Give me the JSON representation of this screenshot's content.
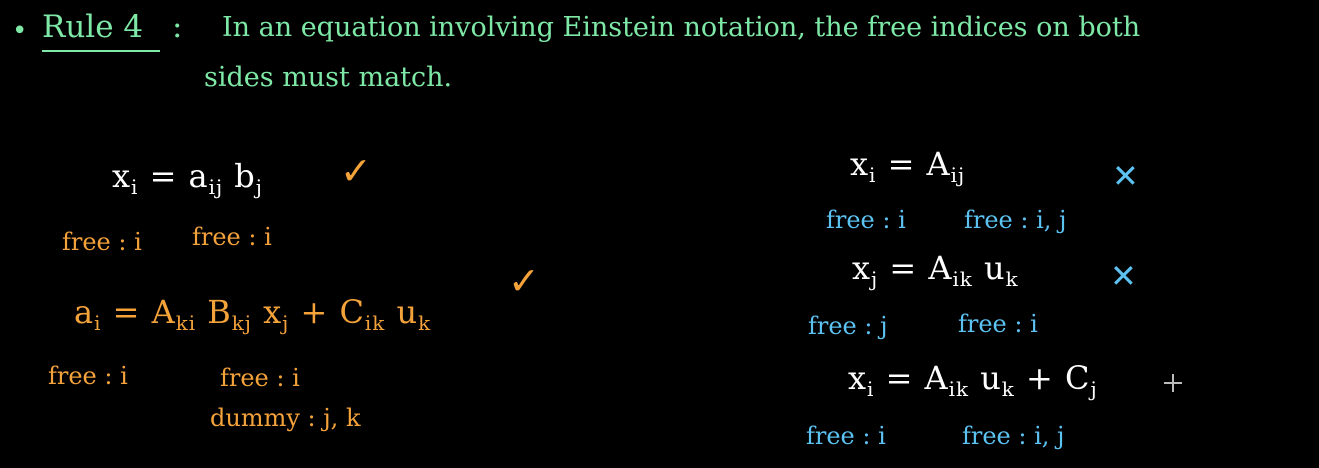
{
  "rule": {
    "bullet": "•",
    "title": "Rule 4",
    "colon": ":",
    "line1": "In an equation involving Einstein notation, the free indices on both",
    "line2": "sides must match."
  },
  "left": {
    "eq1": {
      "pre": "x",
      "s1": "i",
      "m1": " = a",
      "s2": "ij",
      "m2": " b",
      "s3": "j"
    },
    "eq1_mark": "✓",
    "eq1_label_a": "free : i",
    "eq1_label_b": "free : i",
    "eq2": {
      "pre": "a",
      "s1": "i",
      "m1": " = A",
      "s2": "ki",
      "m2": " B",
      "s3": "kj",
      "m3": " x",
      "s4": "j",
      "m4": "  +  C",
      "s5": "ik",
      "m5": " u",
      "s6": "k"
    },
    "eq2_mark": "✓",
    "eq2_label_a": "free : i",
    "eq2_label_b": "free : i",
    "eq2_label_c": "dummy : j, k"
  },
  "right": {
    "eq1": {
      "pre": "x",
      "s1": "i",
      "m1": "  =  A",
      "s2": "ij"
    },
    "eq1_mark": "✕",
    "eq1_label_a": "free : i",
    "eq1_label_b": "free : i, j",
    "eq2": {
      "pre": "x",
      "s1": "j",
      "m1": "  =  A",
      "s2": "ik",
      "m2": " u",
      "s3": "k"
    },
    "eq2_mark": "✕",
    "eq2_label_a": "free : j",
    "eq2_label_b": "free : i",
    "eq3": {
      "pre": "x",
      "s1": "i",
      "m1": " = A",
      "s2": "ik",
      "m2": " u",
      "s3": "k",
      "m3": "  +  C",
      "s4": "j"
    },
    "eq3_label_a": "free : i",
    "eq3_label_b": "free : i, j"
  },
  "colors": {
    "green": "#7ee8a6",
    "orange": "#f4a23a",
    "blue": "#5cc2f2",
    "background": "#000000"
  },
  "icons": {
    "check": "check-mark-icon",
    "cross": "cross-mark-icon",
    "cursor": "crosshair-cursor-icon"
  }
}
